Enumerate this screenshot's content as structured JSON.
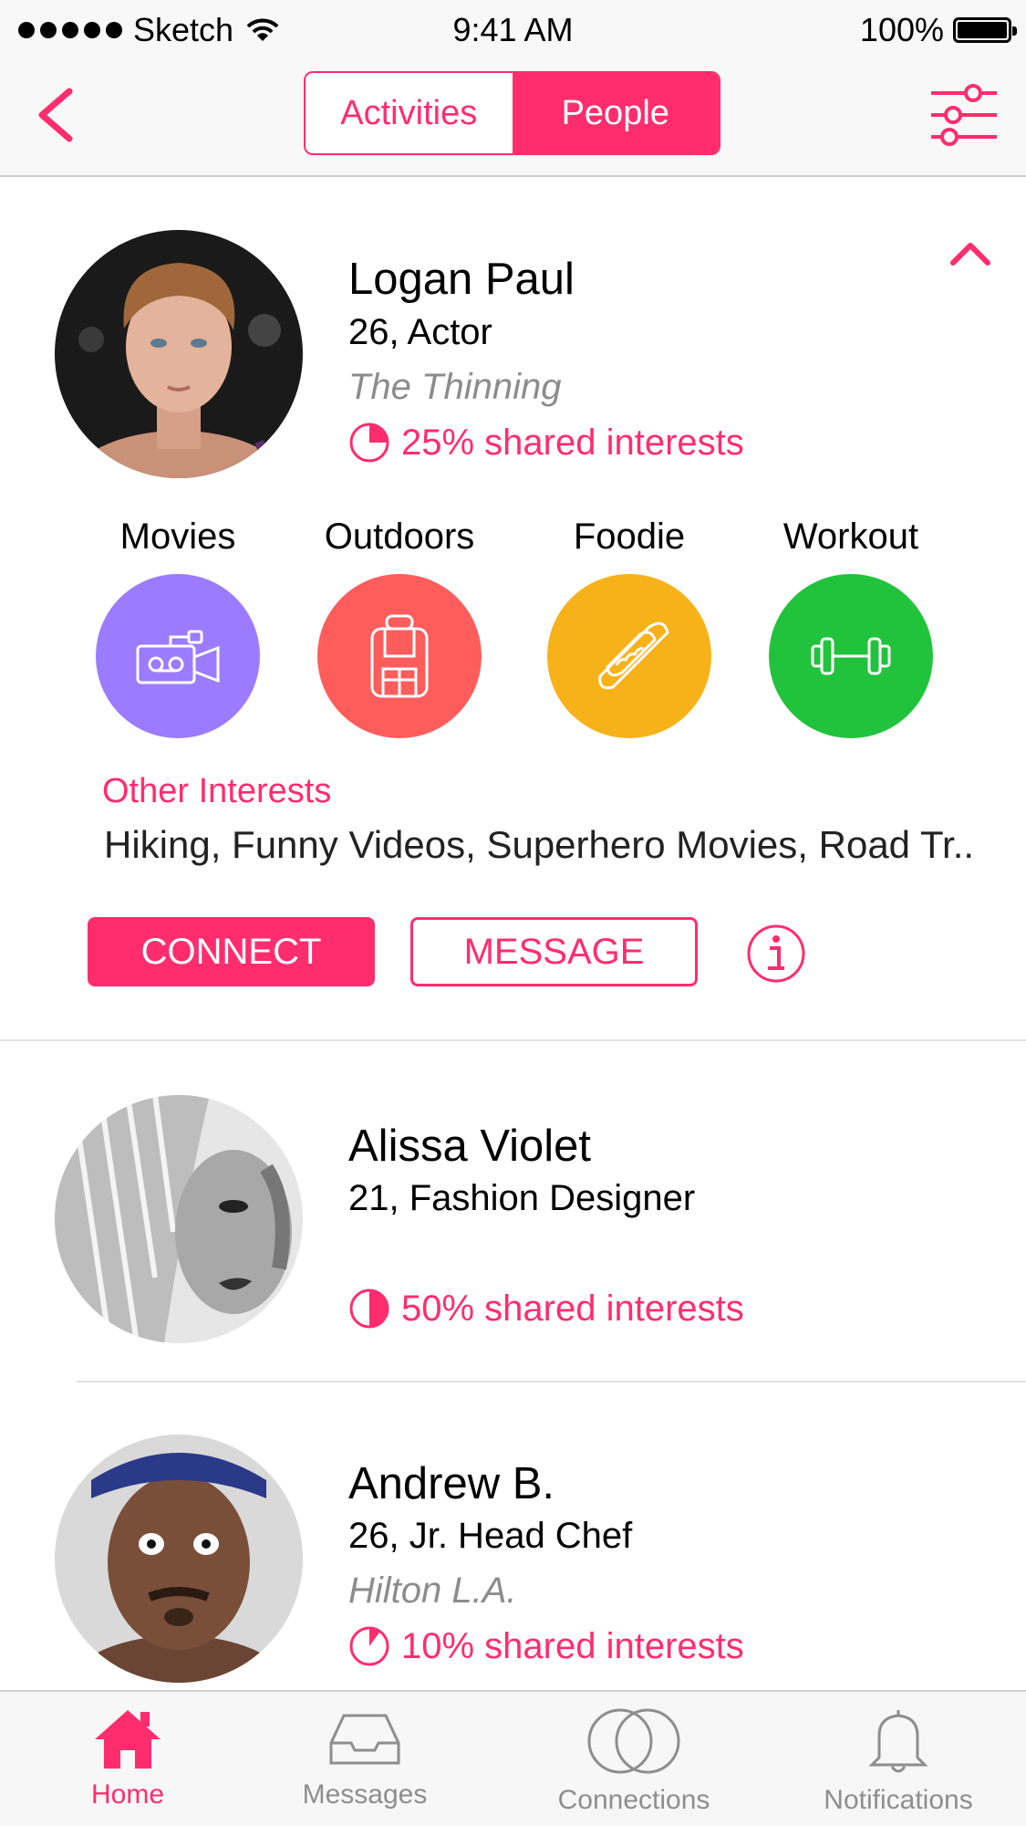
{
  "status_bar": {
    "carrier": "Sketch",
    "time": "9:41 AM",
    "battery": "100%"
  },
  "nav": {
    "segments": [
      {
        "label": "Activities",
        "selected": false
      },
      {
        "label": "People",
        "selected": true
      }
    ]
  },
  "people": [
    {
      "name": "Logan Paul",
      "role": "26, Actor",
      "org": "The Thinning",
      "shared": "25% shared interests",
      "shared_fraction": 0.25,
      "expanded": true,
      "interests": [
        {
          "label": "Movies",
          "icon": "video-camera-icon",
          "color": "#9B7BFF"
        },
        {
          "label": "Outdoors",
          "icon": "backpack-icon",
          "color": "#FF5C5C"
        },
        {
          "label": "Foodie",
          "icon": "hotdog-icon",
          "color": "#F7B21A"
        },
        {
          "label": "Workout",
          "icon": "dumbbell-icon",
          "color": "#22C33C"
        }
      ],
      "other_title": "Other Interests",
      "other_list": "Hiking, Funny Videos, Superhero Movies, Road Tr..",
      "connect_label": "CONNECT",
      "message_label": "MESSAGE"
    },
    {
      "name": "Alissa Violet",
      "role": "21, Fashion Designer",
      "org": "",
      "shared": "50% shared interests",
      "shared_fraction": 0.5
    },
    {
      "name": "Andrew B.",
      "role": "26, Jr. Head Chef",
      "org": "Hilton L.A.",
      "shared": "10% shared interests",
      "shared_fraction": 0.1
    }
  ],
  "tabs": [
    {
      "label": "Home",
      "icon": "home-icon",
      "active": true
    },
    {
      "label": "Messages",
      "icon": "inbox-icon",
      "active": false
    },
    {
      "label": "Connections",
      "icon": "connections-icon",
      "active": false
    },
    {
      "label": "Notifications",
      "icon": "bell-icon",
      "active": false
    }
  ],
  "colors": {
    "accent": "#FF2D6E"
  }
}
